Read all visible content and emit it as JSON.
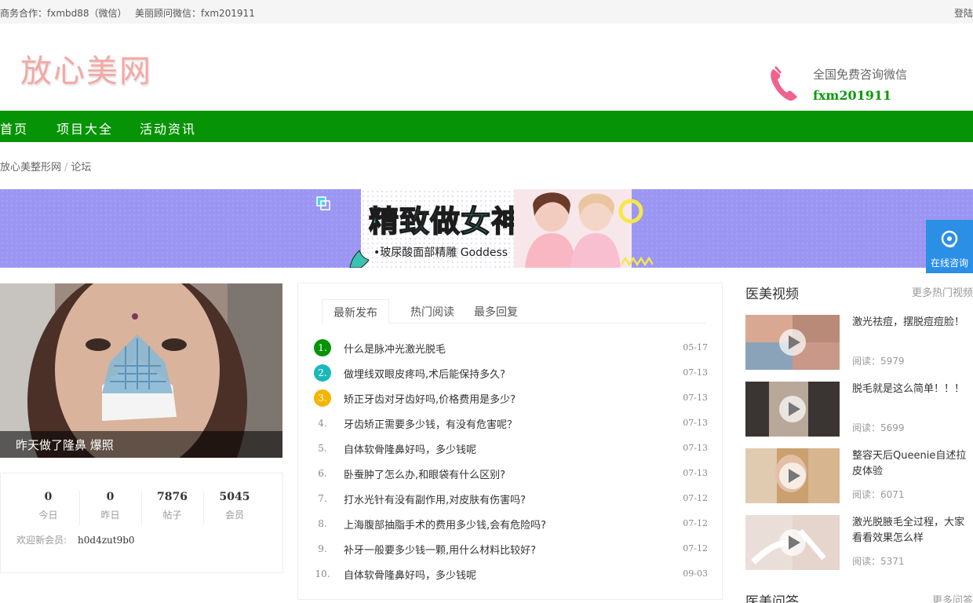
{
  "topbar": {
    "business": "商务合作：fxmbd88（微信）",
    "advisor": "美丽顾问微信：fxm201911",
    "login": "登陆"
  },
  "header": {
    "logo": "放心美网",
    "consult_text": "全国免费咨询微信",
    "consult_wechat": "fxm201911"
  },
  "nav": [
    "首页",
    "项目大全",
    "活动资讯"
  ],
  "breadcrumb": [
    "放心美整形网",
    "论坛"
  ],
  "banner": {
    "title": "精致做女神",
    "subtitle": "•玻尿酸面部精雕 Goddess"
  },
  "float_button": "在线咨询",
  "photo": {
    "caption": "昨天做了隆鼻 爆照"
  },
  "stats": [
    {
      "num": "0",
      "label": "今日"
    },
    {
      "num": "0",
      "label": "昨日"
    },
    {
      "num": "7876",
      "label": "帖子"
    },
    {
      "num": "5045",
      "label": "会员"
    }
  ],
  "welcome": {
    "label": "欢迎新会员:",
    "member": "h0d4zut9b0"
  },
  "tabs": [
    "最新发布",
    "热门阅读",
    "最多回复"
  ],
  "posts": [
    {
      "n": "1.",
      "title": "什么是脉冲光激光脱毛",
      "date": "05-17"
    },
    {
      "n": "2.",
      "title": "做埋线双眼皮疼吗,术后能保持多久?",
      "date": "07-13"
    },
    {
      "n": "3.",
      "title": "矫正牙齿对牙齿好吗,价格费用是多少?",
      "date": "07-13"
    },
    {
      "n": "4.",
      "title": "牙齿矫正需要多少钱，有没有危害呢？",
      "date": "07-13"
    },
    {
      "n": "5.",
      "title": "自体软骨隆鼻好吗，多少钱呢",
      "date": "07-13"
    },
    {
      "n": "6.",
      "title": "卧蚕肿了怎么办,和眼袋有什么区别?",
      "date": "07-13"
    },
    {
      "n": "7.",
      "title": "打水光针有没有副作用,对皮肤有伤害吗?",
      "date": "07-12"
    },
    {
      "n": "8.",
      "title": "上海腹部抽脂手术的费用多少钱,会有危险吗?",
      "date": "07-12"
    },
    {
      "n": "9.",
      "title": "补牙一般要多少钱一颗,用什么材料比较好?",
      "date": "07-12"
    },
    {
      "n": "10.",
      "title": "自体软骨隆鼻好吗，多少钱呢",
      "date": "09-03"
    }
  ],
  "videos_section": {
    "title": "医美视频",
    "more": "更多热门视频"
  },
  "videos": [
    {
      "title": "激光祛痘，摆脱痘痘脸！",
      "reads": "阅读：5979"
    },
    {
      "title": "脱毛就是这么简单！！！",
      "reads": "阅读：5699"
    },
    {
      "title": "整容天后Queenie自述拉皮体验",
      "reads": "阅读：6071"
    },
    {
      "title": "激光脱腋毛全过程，大家看看效果怎么样",
      "reads": "阅读：5371"
    }
  ],
  "qa_section": {
    "title": "医美问答",
    "more": "更多问答"
  },
  "colors": {
    "nav": "#079306",
    "rank1": "#079306",
    "rank2": "#1cb8b8",
    "rank3": "#f5b400",
    "float": "#2b8fe6"
  }
}
